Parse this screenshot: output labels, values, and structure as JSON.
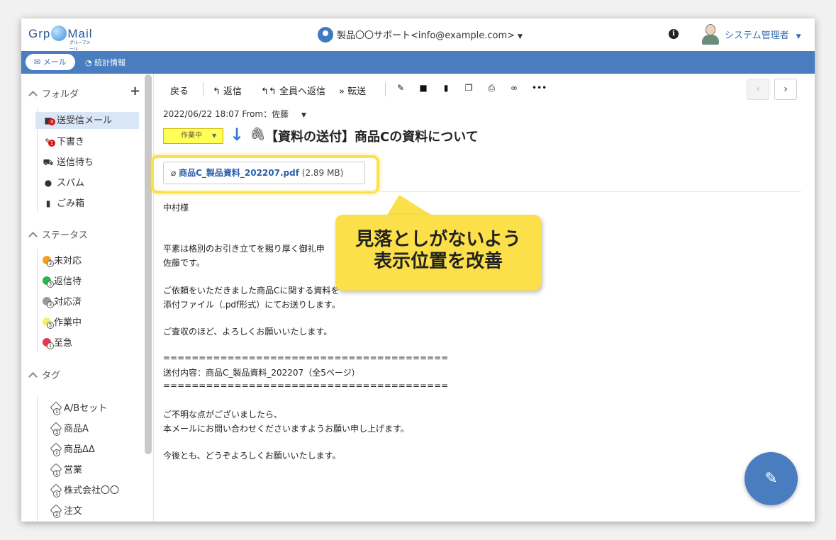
{
  "header": {
    "logo_text": "GrpMail",
    "logo_sub": "グループメール",
    "account": "製品〇〇サポート<info@example.com>",
    "user_name": "システム管理者"
  },
  "nav": {
    "mail_label": "メール",
    "stats_label": "統計情報"
  },
  "sidebar": {
    "folders_title": "フォルダ",
    "folders": [
      {
        "label": "送受信メール",
        "badge": "3"
      },
      {
        "label": "下書き",
        "badge": "1"
      },
      {
        "label": "送信待ち",
        "badge": ""
      },
      {
        "label": "スパム",
        "badge": ""
      },
      {
        "label": "ごみ箱",
        "badge": ""
      }
    ],
    "status_title": "ステータス",
    "statuses": [
      {
        "label": "未対応",
        "count": "3",
        "color": "#f5a020"
      },
      {
        "label": "返信待",
        "count": "3",
        "color": "#2cb34a"
      },
      {
        "label": "対応済",
        "count": "3",
        "color": "#999999"
      },
      {
        "label": "作業中",
        "count": "5",
        "color": "#f7ef6a"
      },
      {
        "label": "至急",
        "count": "1",
        "color": "#e8384f"
      }
    ],
    "tags_title": "タグ",
    "tags": [
      {
        "label": "A/Bセット",
        "count": "1"
      },
      {
        "label": "商品A",
        "count": "3"
      },
      {
        "label": "商品ΔΔ",
        "count": "1"
      },
      {
        "label": "営業",
        "count": "1"
      },
      {
        "label": "株式会社〇〇",
        "count": "1"
      },
      {
        "label": "注文",
        "count": "2"
      }
    ]
  },
  "toolbar": {
    "back": "戻る",
    "reply": "返信",
    "reply_all": "全員へ返信",
    "forward": "転送"
  },
  "mail": {
    "date_from": "2022/06/22 18:07  From：佐藤",
    "status": "作業中",
    "subject": "【資料の送付】商品Cの資料について",
    "attachment_name": "商品C_製品資料_202207.pdf",
    "attachment_size": "(2.89 MB)",
    "body": [
      "中村様",
      "",
      "",
      "平素は格別のお引き立てを賜り厚く御礼申",
      "佐藤です。",
      "",
      "ご依頼をいただきました商品Cに関する資料を",
      "添付ファイル（.pdf形式）にてお送りします。",
      "",
      "ご査収のほど、よろしくお願いいたします。",
      "",
      "========================================",
      "送付内容：商品C_製品資料_202207（全5ページ）",
      "========================================",
      "",
      "ご不明な点がございましたら、",
      "本メールにお問い合わせくださいますようお願い申し上げます。",
      "",
      "今後とも、どうぞよろしくお願いいたします。"
    ]
  },
  "callout": {
    "line1": "見落としがないよう",
    "line2": "表示位置を改善"
  }
}
